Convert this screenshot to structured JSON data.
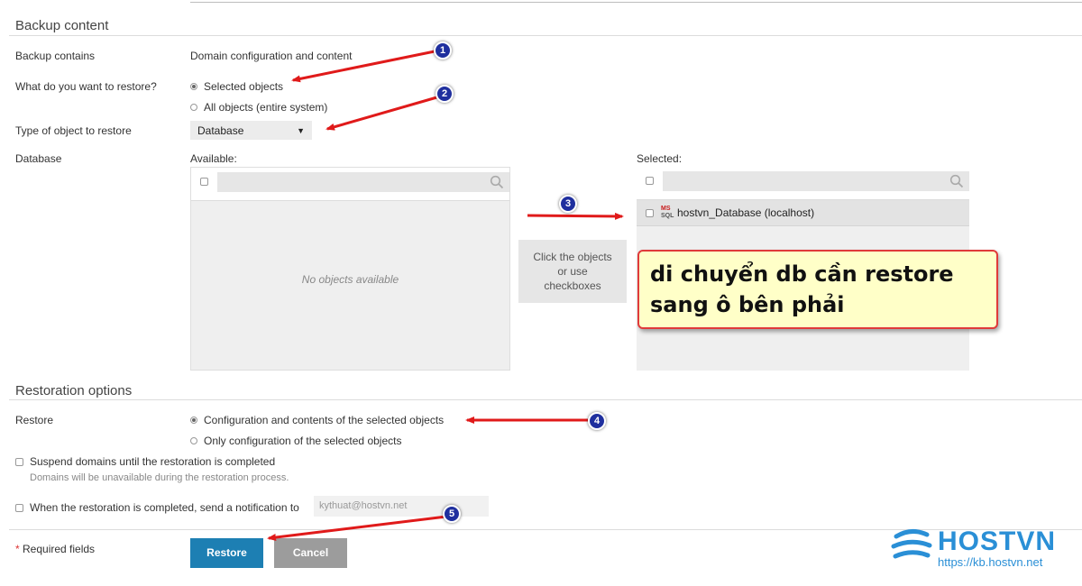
{
  "backup_content": {
    "title": "Backup content",
    "contains_label": "Backup contains",
    "contains_value": "Domain configuration and content",
    "restore_what_label": "What do you want to restore?",
    "opt_selected": "Selected objects",
    "opt_all": "All objects (entire system)",
    "type_label": "Type of object to restore",
    "type_value": "Database",
    "database_label": "Database",
    "available_label": "Available:",
    "selected_label": "Selected:",
    "no_objects": "No objects available",
    "move_hint": "Click the objects or use checkboxes",
    "selected_items": [
      "hostvn_Database (localhost)"
    ],
    "db_icon_text": "MS SQL"
  },
  "restoration_options": {
    "title": "Restoration options",
    "restore_label": "Restore",
    "opt_config_contents": "Configuration and contents of the selected objects",
    "opt_config_only": "Only configuration of the selected objects",
    "suspend_label": "Suspend domains until the restoration is completed",
    "suspend_hint": "Domains will be unavailable during the restoration process.",
    "notify_label": "When the restoration is completed, send a notification to",
    "notify_email": "kythuat@hostvn.net"
  },
  "footer": {
    "required_star": "*",
    "required_text": " Required fields",
    "restore_btn": "Restore",
    "cancel_btn": "Cancel"
  },
  "annotations": {
    "note_text": "di chuyển db cần restore sang ô bên phải",
    "badges": [
      "1",
      "2",
      "3",
      "4",
      "5"
    ],
    "arrow_color": "#e01a1a"
  },
  "brand": {
    "name": "HOSTVN",
    "url": "https://kb.hostvn.net",
    "color": "#2a8fd6"
  }
}
